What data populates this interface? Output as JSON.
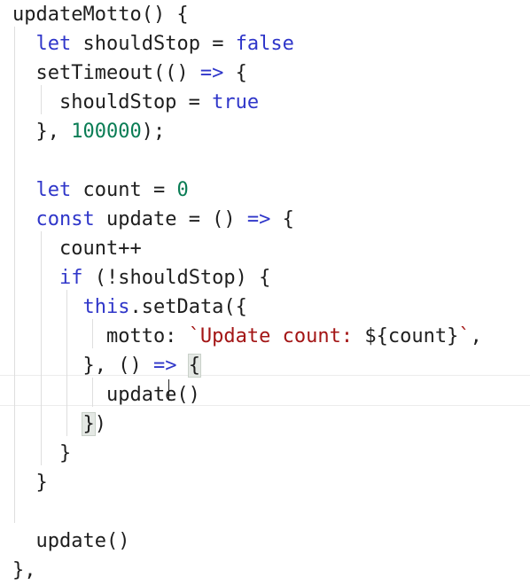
{
  "code": {
    "lines": [
      [
        {
          "t": "updateMotto() {",
          "c": "#1e1e1e"
        }
      ],
      [
        {
          "t": "  ",
          "c": "#1e1e1e"
        },
        {
          "t": "let",
          "c": "#2f36c9"
        },
        {
          "t": " shouldStop = ",
          "c": "#1e1e1e"
        },
        {
          "t": "false",
          "c": "#2f36c9"
        }
      ],
      [
        {
          "t": "  setTimeout(() ",
          "c": "#1e1e1e"
        },
        {
          "t": "=>",
          "c": "#2f36c9"
        },
        {
          "t": " {",
          "c": "#1e1e1e"
        }
      ],
      [
        {
          "t": "    shouldStop = ",
          "c": "#1e1e1e"
        },
        {
          "t": "true",
          "c": "#2f36c9"
        }
      ],
      [
        {
          "t": "  }, ",
          "c": "#1e1e1e"
        },
        {
          "t": "100000",
          "c": "#0a7d55"
        },
        {
          "t": ");",
          "c": "#1e1e1e"
        }
      ],
      [
        {
          "t": "",
          "c": "#1e1e1e"
        }
      ],
      [
        {
          "t": "  ",
          "c": "#1e1e1e"
        },
        {
          "t": "let",
          "c": "#2f36c9"
        },
        {
          "t": " count = ",
          "c": "#1e1e1e"
        },
        {
          "t": "0",
          "c": "#0a7d55"
        }
      ],
      [
        {
          "t": "  ",
          "c": "#1e1e1e"
        },
        {
          "t": "const",
          "c": "#2f36c9"
        },
        {
          "t": " update = () ",
          "c": "#1e1e1e"
        },
        {
          "t": "=>",
          "c": "#2f36c9"
        },
        {
          "t": " {",
          "c": "#1e1e1e"
        }
      ],
      [
        {
          "t": "    count++",
          "c": "#1e1e1e"
        }
      ],
      [
        {
          "t": "    ",
          "c": "#1e1e1e"
        },
        {
          "t": "if",
          "c": "#2f36c9"
        },
        {
          "t": " (!shouldStop) {",
          "c": "#1e1e1e"
        }
      ],
      [
        {
          "t": "      ",
          "c": "#1e1e1e"
        },
        {
          "t": "this",
          "c": "#2f36c9"
        },
        {
          "t": ".setData({",
          "c": "#1e1e1e"
        }
      ],
      [
        {
          "t": "        motto: ",
          "c": "#1e1e1e"
        },
        {
          "t": "`Update count: ",
          "c": "#a31515"
        },
        {
          "t": "${",
          "c": "#1e1e1e"
        },
        {
          "t": "count",
          "c": "#1e1e1e"
        },
        {
          "t": "}",
          "c": "#1e1e1e"
        },
        {
          "t": "`",
          "c": "#a31515"
        },
        {
          "t": ",",
          "c": "#1e1e1e"
        }
      ],
      [
        {
          "t": "      }, () ",
          "c": "#1e1e1e"
        },
        {
          "t": "=>",
          "c": "#2f36c9"
        },
        {
          "t": " ",
          "c": "#1e1e1e"
        },
        {
          "t": "{",
          "c": "#1e1e1e",
          "hl": true
        }
      ],
      [
        {
          "t": "        update()",
          "c": "#1e1e1e"
        }
      ],
      [
        {
          "t": "      ",
          "c": "#1e1e1e"
        },
        {
          "t": "}",
          "c": "#1e1e1e",
          "hl": true
        },
        {
          "t": ")",
          "c": "#1e1e1e"
        }
      ],
      [
        {
          "t": "    }",
          "c": "#1e1e1e"
        }
      ],
      [
        {
          "t": "  }",
          "c": "#1e1e1e"
        }
      ],
      [
        {
          "t": "",
          "c": "#1e1e1e"
        }
      ],
      [
        {
          "t": "  update()",
          "c": "#1e1e1e"
        }
      ],
      [
        {
          "t": "},",
          "c": "#1e1e1e"
        }
      ]
    ],
    "colors": {
      "keyword": "#2f36c9",
      "number": "#0a7d55",
      "string": "#a31515",
      "text": "#1e1e1e"
    }
  }
}
